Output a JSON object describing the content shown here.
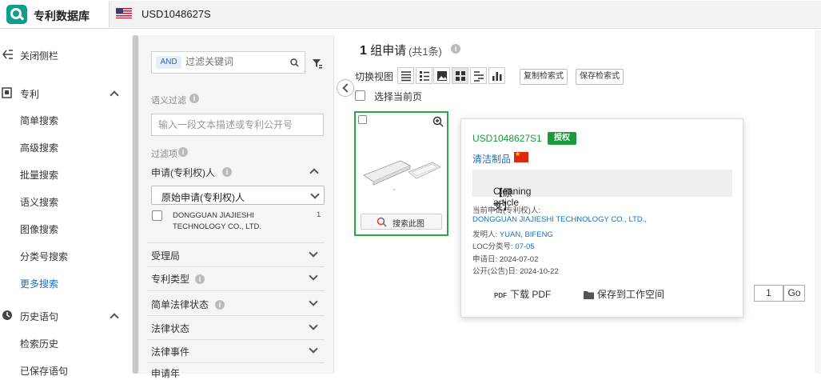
{
  "app": {
    "title": "专利数据库"
  },
  "search": {
    "value": "USD1048627S"
  },
  "sidebar": {
    "close_label": "关闭侧栏",
    "patent_section": "专利",
    "items": [
      "简单搜索",
      "高级搜索",
      "批量搜索",
      "语义搜索",
      "图像搜索",
      "分类号搜索",
      "更多搜索"
    ],
    "history_section": "历史语句",
    "history_items": [
      "检索历史",
      "已保存语句"
    ],
    "active_color": "#1a6fc0"
  },
  "filter": {
    "and_label": "AND",
    "keyword_placeholder": "过滤关键词",
    "semantic_label": "语义过滤",
    "semantic_placeholder": "输入一段文本描述或专利公开号",
    "filters_label": "过滤项",
    "applicant_header": "申请(专利权)人",
    "applicant_select": "原始申请(专利权)人",
    "applicant_options": [
      {
        "name": "DONGGUAN JIAJIESHI TECHNOLOGY CO., LTD.",
        "count": "1"
      }
    ],
    "sections": [
      "受理局",
      "专利类型",
      "简单法律状态",
      "法律状态",
      "法律事件",
      "申请年"
    ]
  },
  "results": {
    "group_count": "1",
    "group_label": "组申请",
    "total": "(共1条)",
    "view_label": "切换视图",
    "copy_query": "复制检索式",
    "save_query": "保存检索式",
    "select_page": "选择当前页",
    "search_image": "搜索此图"
  },
  "patent": {
    "number": "USD1048627S1",
    "status": "授权",
    "title": "清洁制品",
    "original_label": "【原文】",
    "original_title": "Cleaning article",
    "applicant_label": "当前申请(专利权)人:",
    "applicant": "DONGGUAN JIAJIESHI TECHNOLOGY CO., LTD.,",
    "inventor_label": "发明人:",
    "inventor": "YUAN, BIFENG",
    "loc_label": "LOC分类号:",
    "loc": "07-05",
    "app_date_label": "申请日:",
    "app_date": "2024-07-02",
    "pub_date_label": "公开(公告)日:",
    "pub_date": "2024-10-22",
    "download_pdf": "下载 PDF",
    "pdf_tag": "PDF",
    "save_workspace": "保存到工作空间"
  },
  "pager": {
    "page": "1",
    "go": "Go"
  },
  "colors": {
    "brand": "#0f9d8c",
    "granted": "#1b9a3c",
    "link": "#1a6fc0"
  }
}
